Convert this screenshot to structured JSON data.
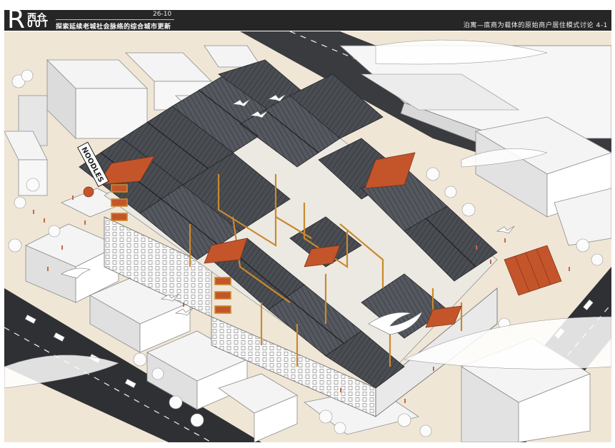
{
  "header": {
    "logo_letter": "R",
    "logo_cn": "西仓",
    "logo_rest": "OOT",
    "code": "26-10",
    "subtitle": "探索延续老城社会脉络的综合城市更新",
    "caption": "泊寓—底商为载体的原始商户居住模式讨论 4-1"
  },
  "drawing": {
    "signage": "NOODLES",
    "colors": {
      "header": "#262626",
      "roof": "#4a4d52",
      "roof_ridge": "#2e3034",
      "timber": "#c98a2e",
      "canopy": "#c4552b",
      "ground": "#efe6d6",
      "road": "#2f3033",
      "context_block": "#f4f4f4",
      "tree": "#f8f8f8",
      "people": "#c26a45"
    }
  }
}
